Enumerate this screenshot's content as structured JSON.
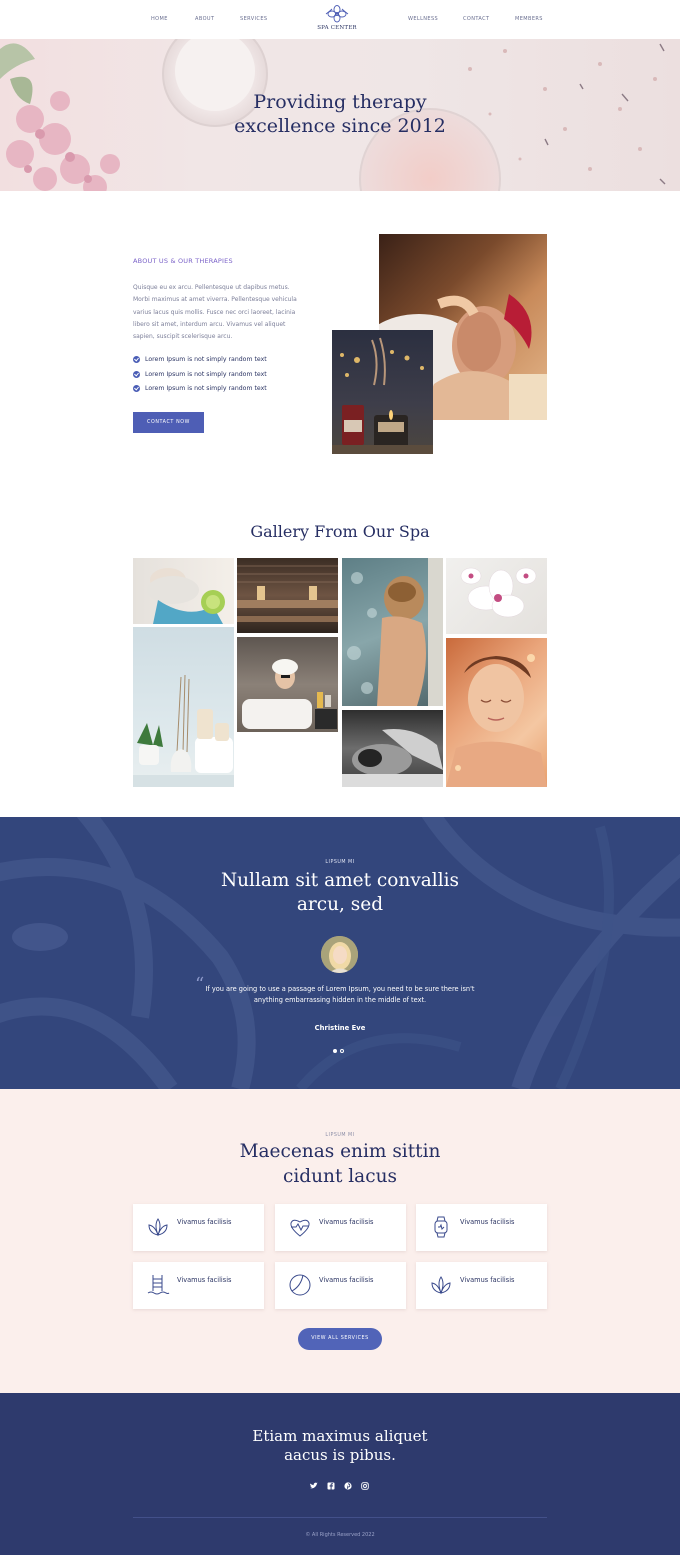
{
  "nav": {
    "left": [
      "HOME",
      "ABOUT",
      "SERVICES"
    ],
    "right": [
      "WELLNESS",
      "CONTACT",
      "MEMBERS"
    ],
    "brand": "SPA CENTER"
  },
  "hero": {
    "line1": "Providing therapy",
    "line2": "excellence since 2012"
  },
  "about": {
    "label": "ABOUT US & OUR THERAPIES",
    "text": "Quisque eu ex arcu. Pellentesque ut dapibus metus. Morbi maximus at amet viverra. Pellentesque vehicula varius lacus quis mollis. Fusce nec orci laoreet, lacinia libero sit amet, interdum arcu. Vivamus vel aliquet sapien, suscipit scelerisque arcu.",
    "checklist": [
      "Lorem Ipsum is not simply random text",
      "Lorem Ipsum is not simply random text",
      "Lorem Ipsum is not simply random text"
    ],
    "button": "CONTACT NOW"
  },
  "gallery": {
    "title": "Gallery From Our Spa"
  },
  "testimonial": {
    "eyebrow": "LIPSUM MI",
    "line1": "Nullam sit amet convallis",
    "line2": "arcu, sed",
    "quote_line1": "If you are going to use a passage of Lorem Ipsum, you need to be sure there isn't",
    "quote_line2": "anything embarrassing hidden in the middle of text.",
    "name": "Christine Eve"
  },
  "services": {
    "eyebrow": "LIPSUM MI",
    "line1": "Maecenas enim sittin",
    "line2": "cidunt lacus",
    "cards": [
      {
        "label": "Vivamus facilisis",
        "icon": "lotus-icon"
      },
      {
        "label": "Vivamus facilisis",
        "icon": "heart-pulse-icon"
      },
      {
        "label": "Vivamus facilisis",
        "icon": "smartwatch-icon"
      },
      {
        "label": "Vivamus facilisis",
        "icon": "pool-ladder-icon"
      },
      {
        "label": "Vivamus facilisis",
        "icon": "ball-icon"
      },
      {
        "label": "Vivamus facilisis",
        "icon": "lotus-icon"
      }
    ],
    "button": "VIEW ALL SERVICES"
  },
  "footer": {
    "line1": "Etiam maximus aliquet",
    "line2": "aacus is pibus.",
    "social": [
      "twitter-icon",
      "facebook-icon",
      "pinterest-icon",
      "instagram-icon"
    ],
    "copyright": "© All Rights Reserved 2022"
  },
  "colors": {
    "navy": "#2e3a6d",
    "accent": "#4e5eb5",
    "purple_label": "#7b63c8",
    "blush": "#fbefec"
  }
}
